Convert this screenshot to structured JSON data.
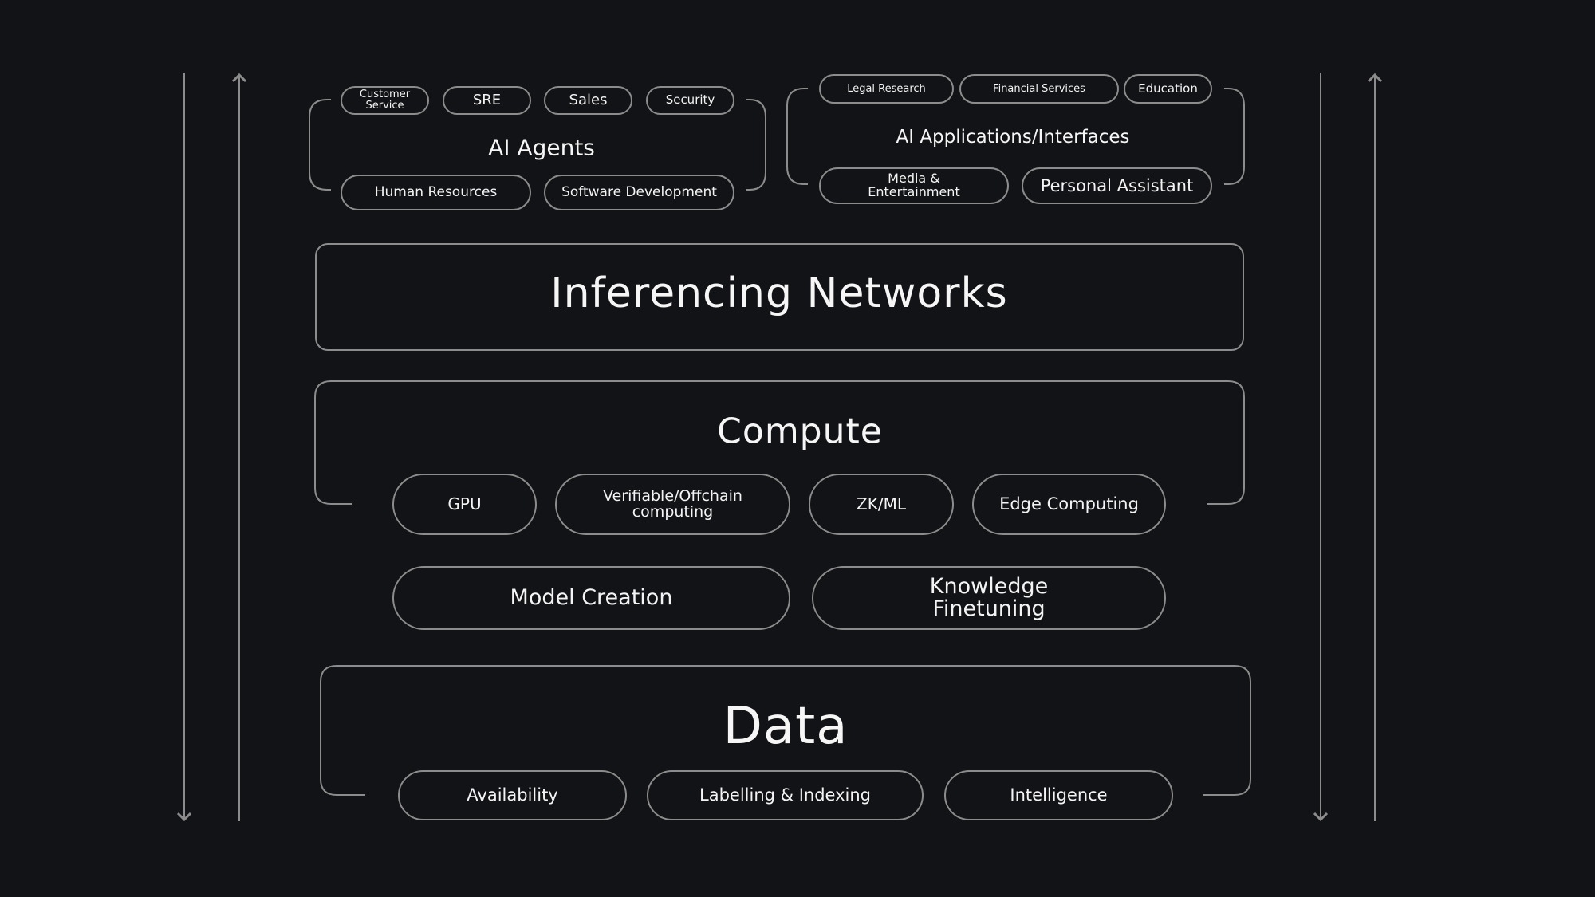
{
  "colors": {
    "background": "#121316",
    "stroke": "#8c8c8c",
    "text": "#f4f4f4"
  },
  "agents": {
    "title": "AI Agents",
    "items": [
      "Customer\nService",
      "SRE",
      "Sales",
      "Security",
      "Human Resources",
      "Software Development"
    ]
  },
  "apps": {
    "title": "AI Applications/Interfaces",
    "items": [
      "Legal Research",
      "Financial Services",
      "Education",
      "Media &\nEntertainment",
      "Personal Assistant"
    ]
  },
  "inferencing": {
    "title": "Inferencing Networks"
  },
  "compute": {
    "title": "Compute",
    "items": [
      "GPU",
      "Verifiable/Offchain\ncomputing",
      "ZK/ML",
      "Edge Computing"
    ]
  },
  "models": {
    "items": [
      "Model Creation",
      "Knowledge\nFinetuning"
    ]
  },
  "data": {
    "title": "Data",
    "items": [
      "Availability",
      "Labelling & Indexing",
      "Intelligence"
    ]
  },
  "arrows": [
    "arrow-down-icon",
    "arrow-up-icon",
    "arrow-down-icon",
    "arrow-up-icon"
  ]
}
